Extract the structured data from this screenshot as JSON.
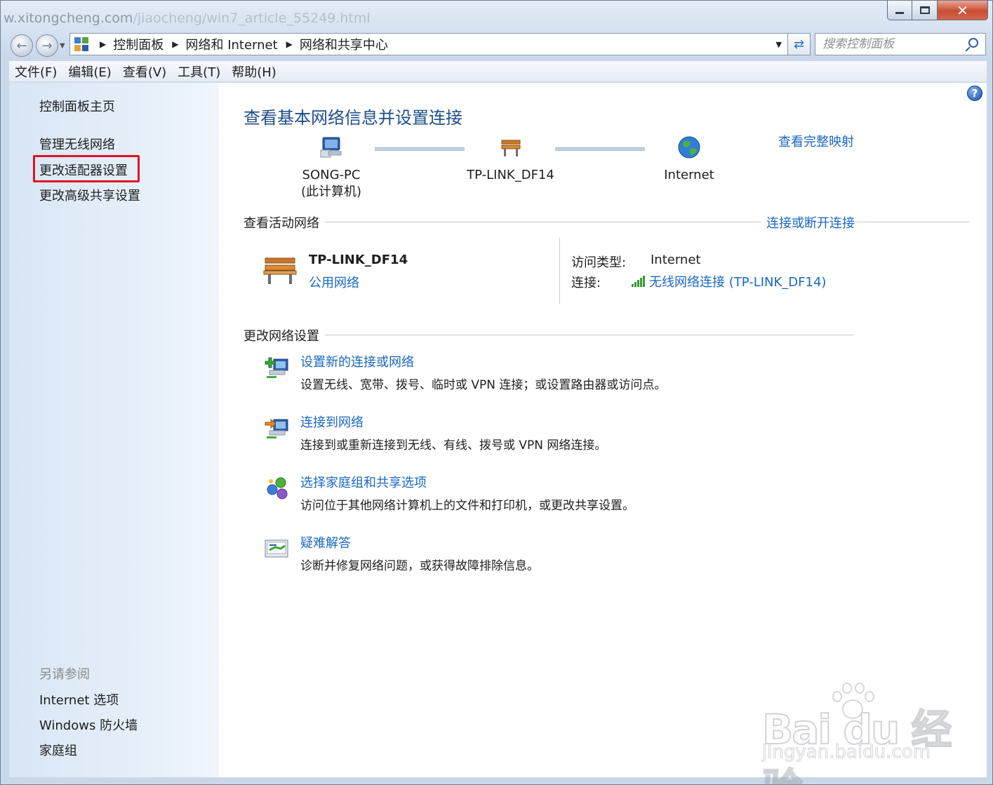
{
  "browser_ghost": {
    "url_prefix": "w.xitongcheng.com",
    "url_rest": "/jiaocheng/win7_article_55249.html"
  },
  "window_controls": {
    "minimize": "minimize",
    "maximize": "maximize",
    "close": "✕"
  },
  "address": {
    "crumbs": [
      "控制面板",
      "网络和 Internet",
      "网络和共享中心"
    ]
  },
  "search": {
    "placeholder": "搜索控制面板"
  },
  "menu": [
    "文件(F)",
    "编辑(E)",
    "查看(V)",
    "工具(T)",
    "帮助(H)"
  ],
  "sidebar": {
    "home": "控制面板主页",
    "links": [
      "管理无线网络",
      "更改适配器设置",
      "更改高级共享设置"
    ],
    "see_also_title": "另请参阅",
    "see_also": [
      "Internet 选项",
      "Windows 防火墙",
      "家庭组"
    ]
  },
  "main": {
    "title": "查看基本网络信息并设置连接",
    "full_map_link": "查看完整映射",
    "nodes": [
      {
        "line1": "SONG-PC",
        "line2": "(此计算机)"
      },
      {
        "line1": "TP-LINK_DF14",
        "line2": ""
      },
      {
        "line1": "Internet",
        "line2": ""
      }
    ],
    "active_section": {
      "title": "查看活动网络",
      "link": "连接或断开连接",
      "network_name": "TP-LINK_DF14",
      "network_type": "公用网络",
      "access_type_label": "访问类型:",
      "access_type_value": "Internet",
      "connection_label": "连接:",
      "connection_value": "无线网络连接 (TP-LINK_DF14)"
    },
    "change_section": {
      "title": "更改网络设置",
      "tasks": [
        {
          "link": "设置新的连接或网络",
          "desc": "设置无线、宽带、拨号、临时或 VPN 连接；或设置路由器或访问点。"
        },
        {
          "link": "连接到网络",
          "desc": "连接到或重新连接到无线、有线、拨号或 VPN 网络连接。"
        },
        {
          "link": "选择家庭组和共享选项",
          "desc": "访问位于其他网络计算机上的文件和打印机，或更改共享设置。"
        },
        {
          "link": "疑难解答",
          "desc": "诊断并修复网络问题，或获得故障排除信息。"
        }
      ]
    }
  },
  "watermark": {
    "logo": "Bai du 经验",
    "url": "jingyan.baidu.com"
  },
  "colors": {
    "link": "#1a67c2",
    "title": "#1d4e89",
    "highlight": "#e0141f",
    "sidebar": "#d8e6f5"
  }
}
